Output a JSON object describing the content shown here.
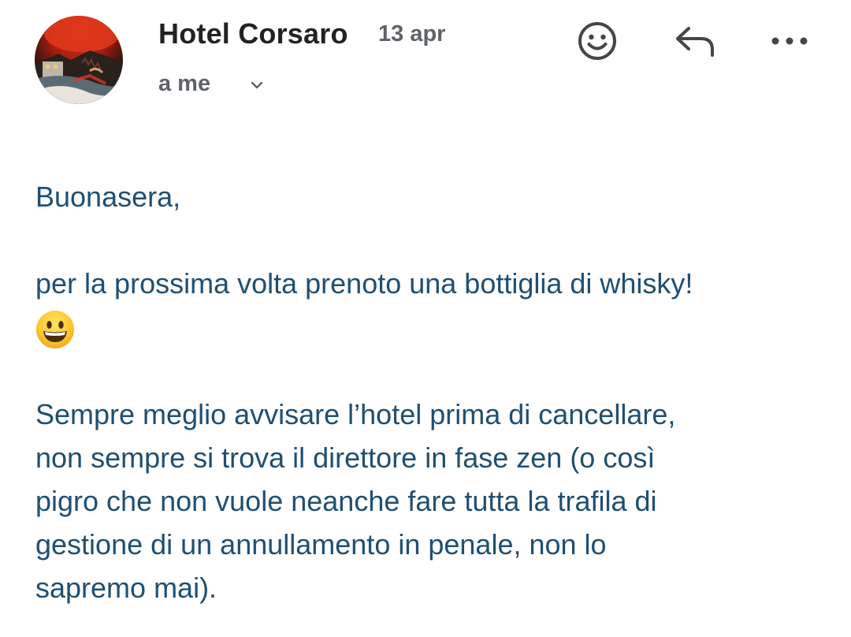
{
  "email": {
    "sender_name": "Hotel Corsaro",
    "date": "13 apr",
    "recipient": "a me"
  },
  "toolbar": {
    "emoji_icon": "smiley-icon",
    "reply_icon": "reply-icon",
    "more_icon": "more-horizontal-icon"
  },
  "message": {
    "greeting": "Buonasera,",
    "line1": "per la prossima volta prenoto una bottiglia di whisky!",
    "emoji": "grinning-face-emoji",
    "paragraph2_lines": [
      "Sempre meglio avvisare l’hotel prima di cancellare,",
      "non sempre si trova il direttore in fase zen (o così",
      "pigro che non vuole neanche fare tutta la trafila di",
      "gestione di un annullamento in penale, non lo",
      "sapremo mai)."
    ]
  },
  "colors": {
    "body_text": "#1e4f73",
    "sender_text": "#222222",
    "meta_text": "#5f6368",
    "icon": "#444746"
  }
}
